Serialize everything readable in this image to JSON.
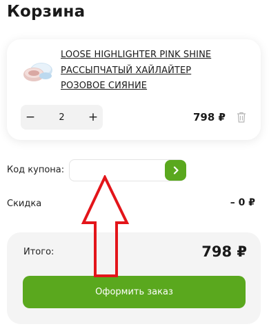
{
  "page": {
    "title": "Корзина"
  },
  "cart_item": {
    "name_line1": "LOOSE HIGHLIGHTER PINK SHINE",
    "name_line2": "РАССЫПЧАТЫЙ ХАЙЛАЙТЕР",
    "name_line3": "РОЗОВОЕ СИЯНИЕ",
    "quantity": "2",
    "decrement_symbol": "−",
    "increment_symbol": "+",
    "price": "798 ₽"
  },
  "coupon": {
    "label": "Код купона:",
    "value": "",
    "placeholder": ""
  },
  "discount": {
    "label": "Скидка",
    "value": "– 0 ₽"
  },
  "summary": {
    "total_label": "Итого:",
    "total_value": "798 ₽",
    "checkout_label": "Оформить заказ"
  },
  "colors": {
    "accent": "#5aa81e",
    "arrow": "#e3151a",
    "summary_bg": "#f4f4f4"
  },
  "icons": [
    "product-thumbnail",
    "trash-icon",
    "chevron-right-icon",
    "red-up-arrow-annotation"
  ]
}
